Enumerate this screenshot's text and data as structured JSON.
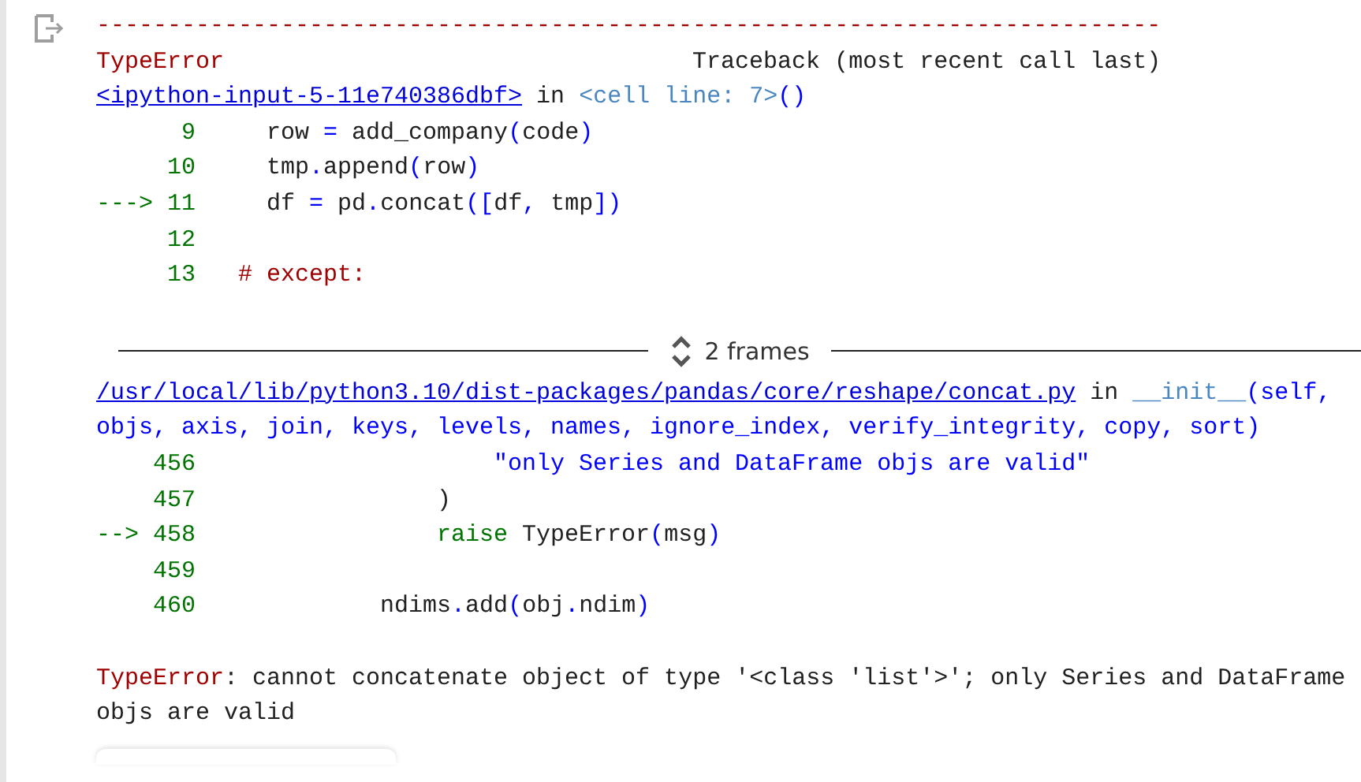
{
  "traceback": {
    "separator": "---------------------------------------------------------------------------",
    "error_name": "TypeError",
    "label": "Traceback (most recent call last)"
  },
  "frames": [
    {
      "header": [
        [
          {
            "text": "<ipython-input-5-11e740386dbf>",
            "kind": "link"
          },
          {
            "text": " in ",
            "kind": "text"
          },
          {
            "text": "<cell line: 7>",
            "kind": "name"
          },
          {
            "text": "()",
            "kind": "op"
          }
        ]
      ],
      "lines": [
        {
          "number": "9",
          "code": [
            {
              "text": "  row ",
              "kind": "text"
            },
            {
              "text": "=",
              "kind": "op"
            },
            {
              "text": " add_company",
              "kind": "text"
            },
            {
              "text": "(",
              "kind": "op"
            },
            {
              "text": "code",
              "kind": "text"
            },
            {
              "text": ")",
              "kind": "op"
            }
          ]
        },
        {
          "number": "10",
          "code": [
            {
              "text": "  tmp",
              "kind": "text"
            },
            {
              "text": ".",
              "kind": "op"
            },
            {
              "text": "append",
              "kind": "text"
            },
            {
              "text": "(",
              "kind": "op"
            },
            {
              "text": "row",
              "kind": "text"
            },
            {
              "text": ")",
              "kind": "op"
            }
          ]
        },
        {
          "arrow": "--->",
          "number": "11",
          "code": [
            {
              "text": "  df ",
              "kind": "text"
            },
            {
              "text": "=",
              "kind": "op"
            },
            {
              "text": " pd",
              "kind": "text"
            },
            {
              "text": ".",
              "kind": "op"
            },
            {
              "text": "concat",
              "kind": "text"
            },
            {
              "text": "([",
              "kind": "op"
            },
            {
              "text": "df",
              "kind": "text"
            },
            {
              "text": ",",
              "kind": "op"
            },
            {
              "text": " tmp",
              "kind": "text"
            },
            {
              "text": "])",
              "kind": "op"
            }
          ]
        },
        {
          "number": "12"
        },
        {
          "number": "13",
          "code": [
            {
              "text": "# except:",
              "kind": "comment"
            }
          ]
        }
      ]
    },
    {
      "header": [
        [
          {
            "text": "/usr/local/lib/python3.10/dist-packages/pandas/core/reshape/concat.py",
            "kind": "link"
          },
          {
            "text": " in ",
            "kind": "text"
          },
          {
            "text": "__init__",
            "kind": "name"
          },
          {
            "text": "(self,",
            "kind": "op"
          }
        ],
        [
          {
            "text": "objs, axis, join, keys, levels, names, ignore_index, verify_integrity, copy, sort)",
            "kind": "op"
          }
        ]
      ],
      "lines": [
        {
          "number": "456",
          "code": [
            {
              "text": "                  \"only Series and DataFrame objs are valid\"",
              "kind": "str"
            }
          ]
        },
        {
          "number": "457",
          "code": [
            {
              "text": "              )",
              "kind": "text"
            }
          ]
        },
        {
          "arrow": "-->",
          "number": "458",
          "code": [
            {
              "text": "              raise",
              "kind": "kw"
            },
            {
              "text": " TypeError",
              "kind": "text"
            },
            {
              "text": "(",
              "kind": "op"
            },
            {
              "text": "msg",
              "kind": "text"
            },
            {
              "text": ")",
              "kind": "op"
            }
          ]
        },
        {
          "number": "459"
        },
        {
          "number": "460",
          "code": [
            {
              "text": "          ndims",
              "kind": "text"
            },
            {
              "text": ".",
              "kind": "op"
            },
            {
              "text": "add",
              "kind": "text"
            },
            {
              "text": "(",
              "kind": "op"
            },
            {
              "text": "obj",
              "kind": "text"
            },
            {
              "text": ".",
              "kind": "op"
            },
            {
              "text": "ndim",
              "kind": "text"
            },
            {
              "text": ")",
              "kind": "op"
            }
          ]
        }
      ]
    }
  ],
  "collapsed_frames": {
    "label": "2 frames"
  },
  "exception": {
    "name": "TypeError",
    "message": ": cannot concatenate object of type '<class 'list'>'; only Series and DataFrame objs are valid"
  }
}
